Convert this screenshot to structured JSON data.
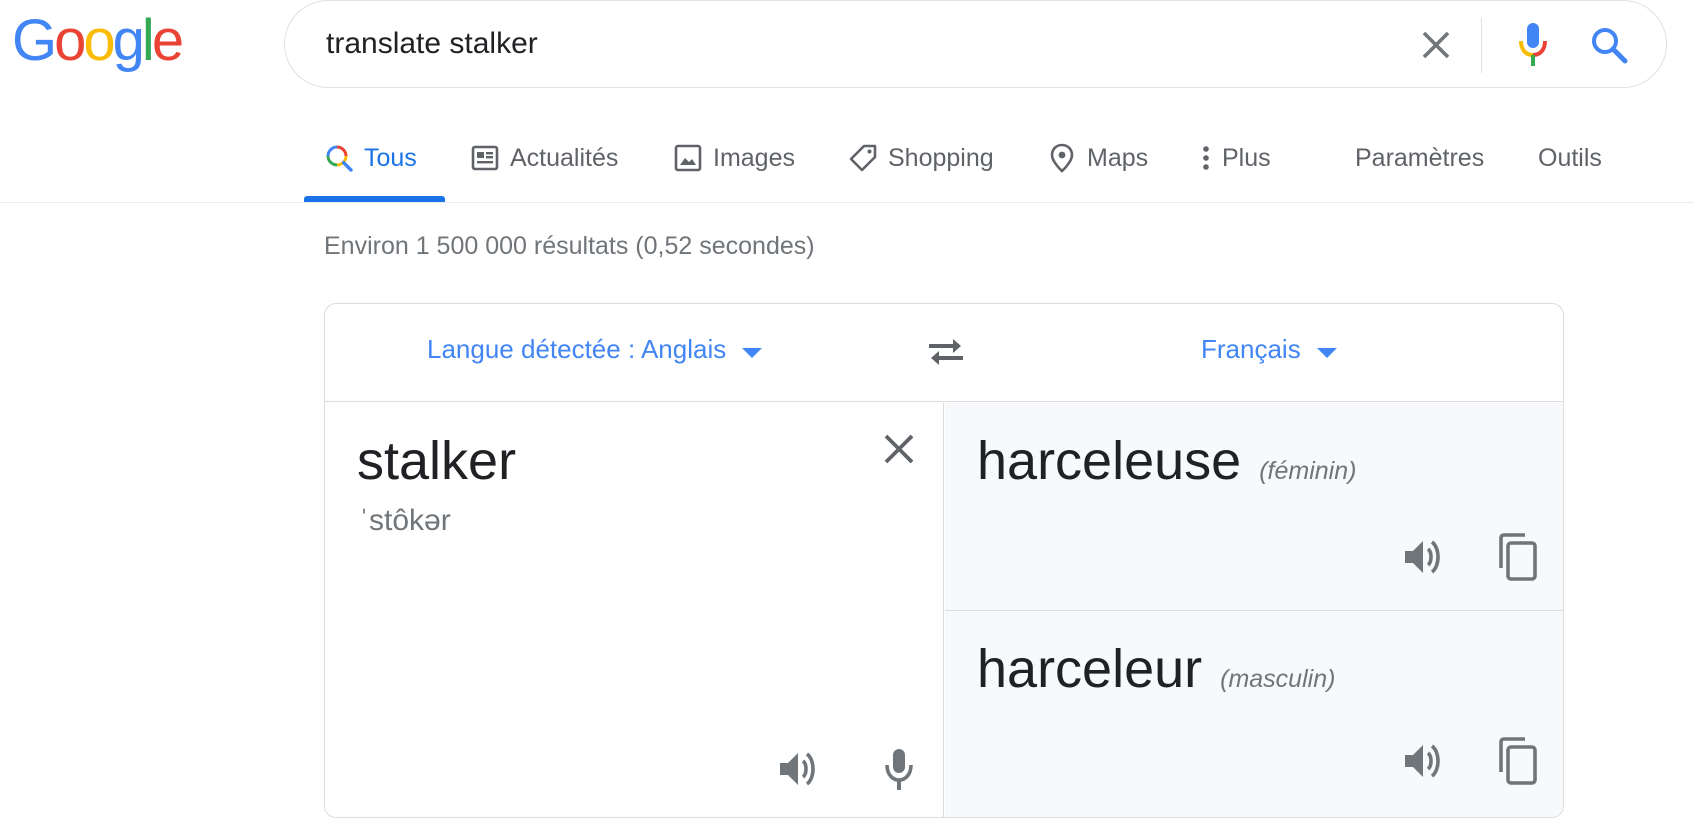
{
  "logo": {
    "letters": [
      "G",
      "o",
      "o",
      "g",
      "l",
      "e"
    ],
    "colors": [
      "#4285f4",
      "#ea4335",
      "#fbbc05",
      "#4285f4",
      "#34a853",
      "#ea4335"
    ]
  },
  "search": {
    "query": "translate stalker"
  },
  "tabs": {
    "items": [
      {
        "label": "Tous",
        "icon": "search-multicolor-icon",
        "active": true
      },
      {
        "label": "Actualités",
        "icon": "news-icon"
      },
      {
        "label": "Images",
        "icon": "image-icon"
      },
      {
        "label": "Shopping",
        "icon": "tag-icon"
      },
      {
        "label": "Maps",
        "icon": "map-pin-icon"
      },
      {
        "label": "Plus",
        "icon": "more-vertical-icon"
      }
    ],
    "settings": "Paramètres",
    "tools": "Outils"
  },
  "result_stats": "Environ 1 500 000 résultats (0,52 secondes)",
  "translate": {
    "source_lang": "Langue détectée : Anglais",
    "target_lang": "Français",
    "source_word": "stalker",
    "phonetic": "ˈstôkər",
    "translations": [
      {
        "word": "harceleuse",
        "gender": "(féminin)"
      },
      {
        "word": "harceleur",
        "gender": "(masculin)"
      }
    ]
  },
  "colors": {
    "accent": "#1a73e8",
    "link": "#4285f4",
    "icon": "#70757a"
  }
}
